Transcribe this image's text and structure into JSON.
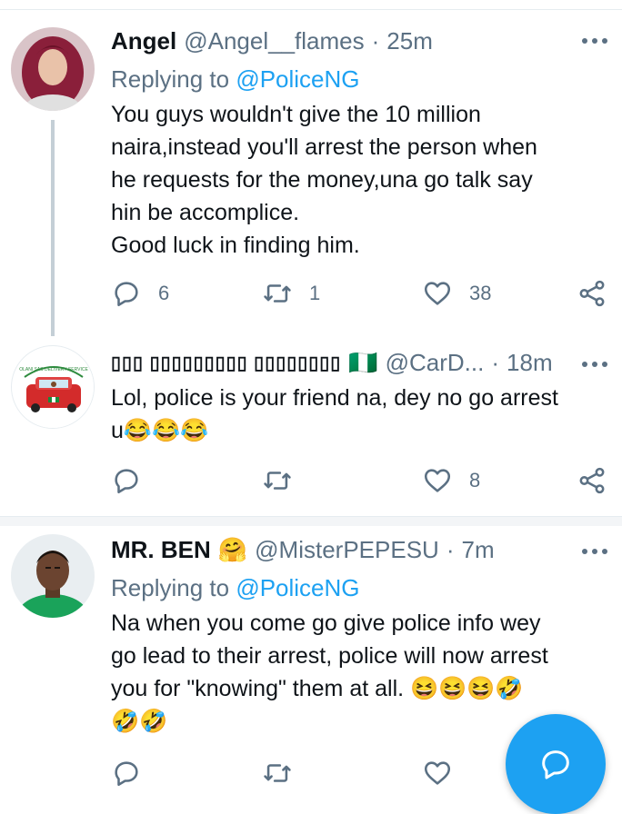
{
  "tweets": [
    {
      "name": "Angel",
      "handle": "@Angel__flames",
      "time": "25m",
      "replying_prefix": "Replying to ",
      "replying_to": "@PoliceNG",
      "text": "You guys wouldn't give the 10 million\nnaira,instead you'll arrest the person when\nhe requests for the money,una go talk say\nhin be accomplice.\nGood luck in finding him.",
      "replies": "6",
      "retweets": "1",
      "likes": "38"
    },
    {
      "name": "▯▯▯ ▯▯▯▯▯▯▯▯▯ ▯▯▯▯▯▯▯▯",
      "name_flag": "🇳🇬",
      "handle": "@CarD...",
      "time": "18m",
      "text": "Lol, police is your friend na, dey no go arrest\nu😂😂😂",
      "replies": "",
      "retweets": "",
      "likes": "8"
    },
    {
      "name": "MR. BEN",
      "name_emoji": "🤗",
      "handle": "@MisterPEPESU",
      "time": "7m",
      "replying_prefix": "Replying to ",
      "replying_to": "@PoliceNG",
      "text": "Na when you come go give police info wey\ngo lead to their arrest, police will now arrest\nyou for \"knowing\" them at all. 😆😆😆🤣\n🤣🤣",
      "replies": "",
      "retweets": "",
      "likes": ""
    }
  ],
  "avatar_badge_text": "OLANI SAS DELIVERY SERVICE",
  "icons": {
    "reply": "reply-icon",
    "retweet": "retweet-icon",
    "like": "heart-icon",
    "share": "share-icon",
    "more": "more-icon",
    "compose": "compose-icon"
  },
  "colors": {
    "accent": "#1da1f2",
    "secondary_text": "#5b7083",
    "primary_text": "#0f1419"
  }
}
